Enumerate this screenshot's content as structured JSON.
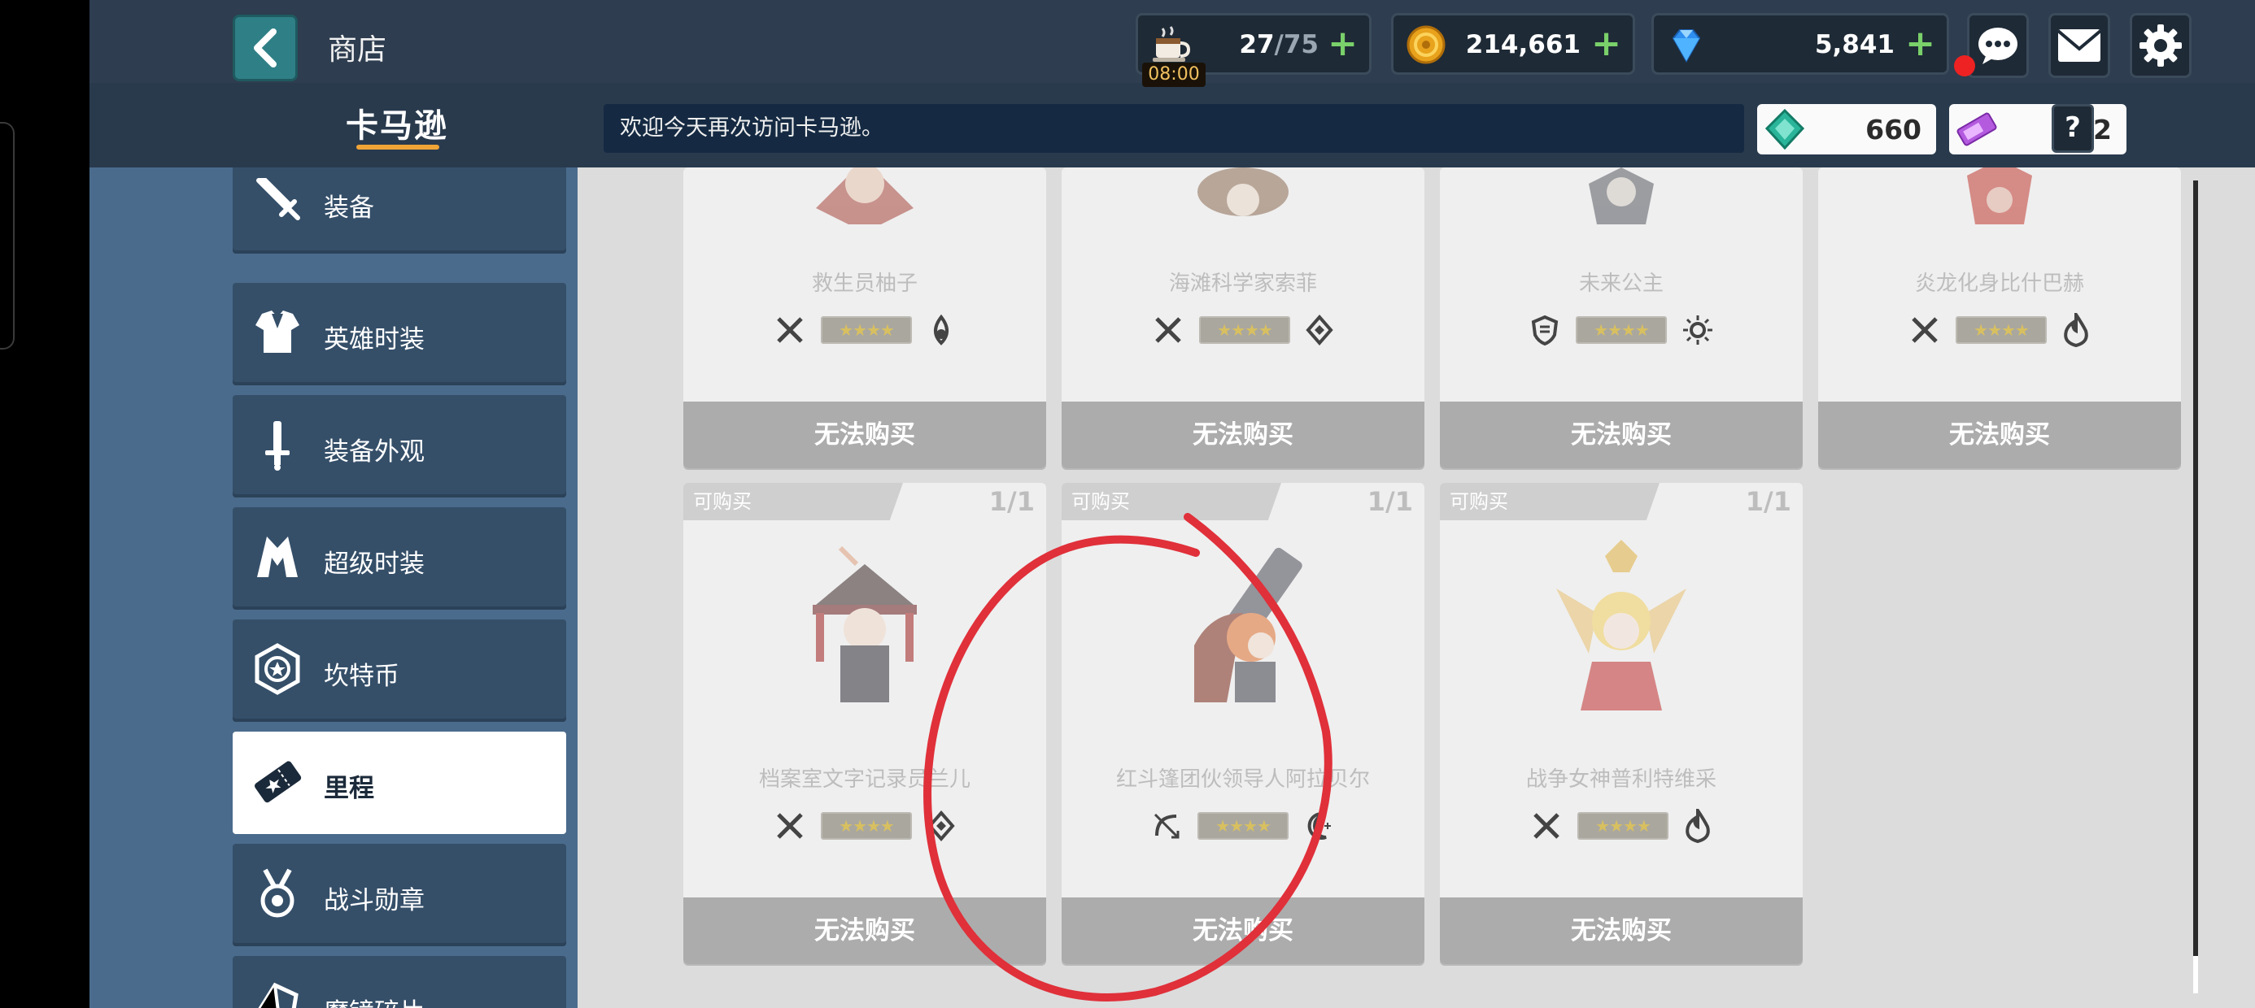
{
  "header": {
    "title": "商店",
    "tab_label": "卡马逊",
    "notice": "欢迎今天再次访问卡马逊。"
  },
  "resources": {
    "stamina": {
      "current": "27",
      "max": "/75",
      "timer": "08:00",
      "icon": "coffee-cup-icon"
    },
    "gold": {
      "value": "214,661",
      "icon": "gold-coin-icon"
    },
    "gems": {
      "value": "5,841",
      "icon": "blue-gem-icon"
    },
    "plus": "+"
  },
  "top_buttons": [
    "chat-icon",
    "mail-icon",
    "gear-icon"
  ],
  "currencies": [
    {
      "value": "660",
      "icon": "green-crystal-icon"
    },
    {
      "value": "302",
      "icon": "purple-ticket-icon"
    }
  ],
  "help": "?",
  "sidebar": {
    "items": [
      {
        "label": "装备",
        "icon": "sword-icon"
      },
      {
        "label": "英雄时装",
        "icon": "costume-icon"
      },
      {
        "label": "装备外观",
        "icon": "sword-skin-icon"
      },
      {
        "label": "超级时装",
        "icon": "super-costume-icon"
      },
      {
        "label": "坎特币",
        "icon": "kanterbury-coin-icon"
      },
      {
        "label": "里程",
        "icon": "mileage-ticket-icon",
        "active": true
      },
      {
        "label": "战斗勋章",
        "icon": "medal-icon"
      },
      {
        "label": "魔镜碎片",
        "icon": "mirror-shard-icon"
      }
    ]
  },
  "cards_row1": [
    {
      "name": "救生员柚子",
      "buy": "无法购买",
      "class": "sword-icon",
      "element": "dark-drop-icon"
    },
    {
      "name": "海滩科学家索菲",
      "buy": "无法购买",
      "class": "sword-icon",
      "element": "earth-diamond-icon"
    },
    {
      "name": "未来公主",
      "buy": "无法购买",
      "class": "shield-icon",
      "element": "light-sun-icon"
    },
    {
      "name": "炎龙化身比什巴赫",
      "buy": "无法购买",
      "class": "sword-icon",
      "element": "fire-icon"
    }
  ],
  "cards_row2": [
    {
      "name": "档案室文字记录员兰儿",
      "badge": "可购买",
      "limit": "1/1",
      "buy": "无法购买",
      "class": "sword-icon",
      "element": "earth-diamond-icon"
    },
    {
      "name": "红斗篷团伙领导人阿拉贝尔",
      "badge": "可购买",
      "limit": "1/1",
      "buy": "无法购买",
      "class": "bow-icon",
      "element": "moon-icon"
    },
    {
      "name": "战争女神普利特维采",
      "badge": "可购买",
      "limit": "1/1",
      "buy": "无法购买",
      "class": "sword-icon",
      "element": "fire-icon"
    }
  ],
  "stars": "★★★★",
  "colors": {
    "header_bg": "#2e3d4f",
    "sidebar_bg": "#4a6b8c",
    "accent_underline": "#f0a436",
    "annotation_red": "#e0303a"
  }
}
